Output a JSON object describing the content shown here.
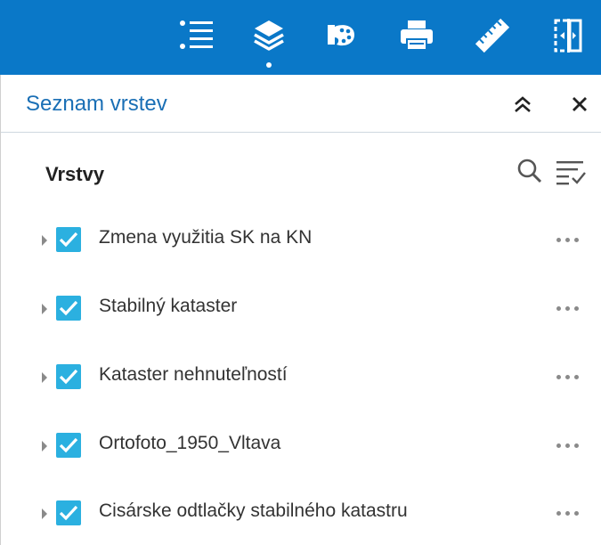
{
  "toolbar": {
    "items": [
      {
        "icon": "layer-list-icon",
        "active": false
      },
      {
        "icon": "layers-icon",
        "active": true
      },
      {
        "icon": "palette-icon",
        "active": false
      },
      {
        "icon": "print-icon",
        "active": false
      },
      {
        "icon": "ruler-icon",
        "active": false
      },
      {
        "icon": "swipe-icon",
        "active": false
      }
    ],
    "color": "#0a78c8"
  },
  "panel": {
    "title": "Seznam vrstev",
    "collapse_icon": "chevron-double-up-icon",
    "close_icon": "close-icon"
  },
  "section": {
    "title": "Vrstvy",
    "search_icon": "search-icon",
    "filter_icon": "filter-list-icon"
  },
  "layers": [
    {
      "label": "Zmena využitia SK na KN",
      "checked": true
    },
    {
      "label": "Stabilný kataster",
      "checked": true
    },
    {
      "label": "Kataster nehnuteľností",
      "checked": true
    },
    {
      "label": "Ortofoto_1950_Vltava",
      "checked": true
    },
    {
      "label": "Cisárske odtlačky stabilného katastru",
      "checked": true
    }
  ],
  "colors": {
    "title": "#1a6fb5",
    "checkbox": "#2bb0e0"
  }
}
